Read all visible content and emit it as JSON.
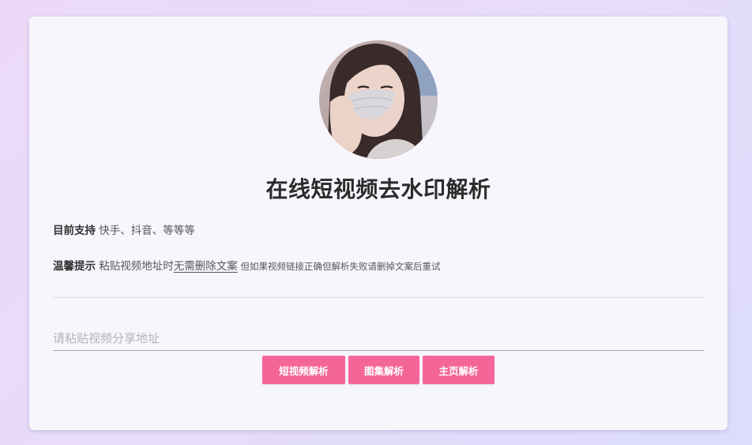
{
  "header": {
    "title": "在线短视频去水印解析",
    "avatar_alt": "avatar"
  },
  "support": {
    "label": "目前支持",
    "text": " 快手、抖音、等等等"
  },
  "tip": {
    "label": "温馨提示",
    "text_before": " 粘贴视频地址时",
    "underlined": "无需删除文案",
    "small_text": " 但如果视频链接正确但解析失败请删掉文案后重试"
  },
  "form": {
    "url_value": "",
    "url_placeholder": "请粘贴视频分享地址"
  },
  "buttons": {
    "video_parse": "短视频解析",
    "album_parse": "图集解析",
    "homepage_parse": "主页解析"
  },
  "colors": {
    "accent": "#f56698",
    "card_bg": "#f8f6fd",
    "page_bg": "#e7dcfb"
  }
}
